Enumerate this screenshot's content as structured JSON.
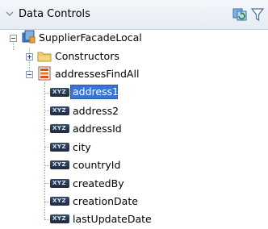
{
  "panel": {
    "title": "Data Controls"
  },
  "tree": {
    "root": {
      "label": "SupplierFacadeLocal"
    },
    "constructors": {
      "label": "Constructors"
    },
    "collection": {
      "label": "addressesFindAll"
    },
    "attributes": [
      {
        "label": "address1"
      },
      {
        "label": "address2"
      },
      {
        "label": "addressId"
      },
      {
        "label": "city"
      },
      {
        "label": "countryId"
      },
      {
        "label": "createdBy"
      },
      {
        "label": "creationDate"
      },
      {
        "label": "lastUpdateDate"
      }
    ],
    "attribute_icon": "XYZ",
    "selected_index": 0
  },
  "colors": {
    "selection": "#3875d7",
    "header_background": "#e6ecf4"
  },
  "icons": {
    "header": [
      "chevron-down-icon",
      "refresh-icon",
      "filter-icon"
    ],
    "root": "bean-icon",
    "constructors": "folder-icon",
    "collection": "collection-icon",
    "attribute": "attribute-icon"
  }
}
